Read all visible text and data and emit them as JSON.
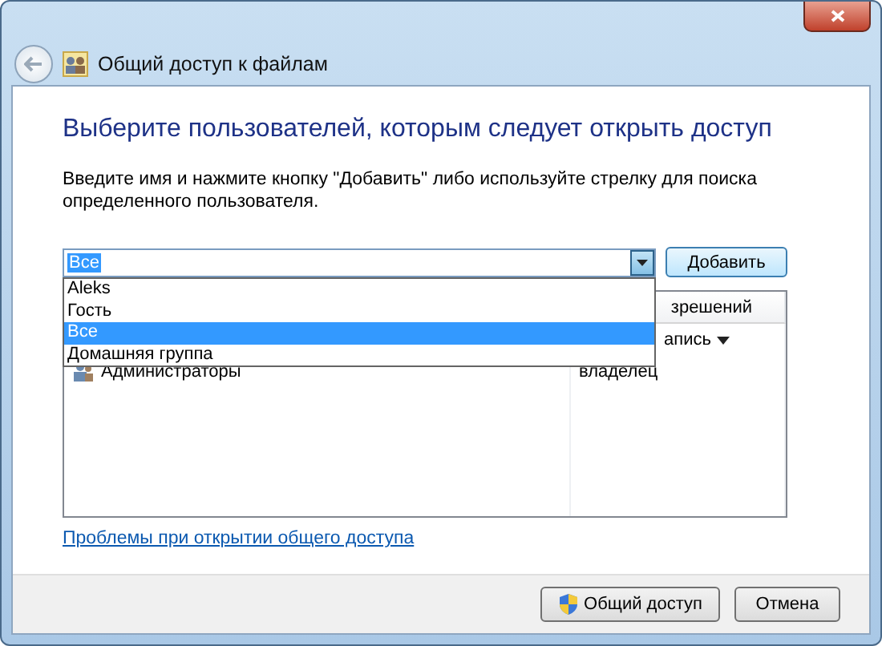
{
  "window": {
    "title": "Общий доступ к файлам"
  },
  "heading": "Выберите пользователей, которым следует открыть доступ",
  "instruction": "Введите имя и нажмите кнопку \"Добавить\" либо используйте стрелку для поиска определенного пользователя.",
  "combo": {
    "value": "Все",
    "expanded": true,
    "options": [
      {
        "label": "Aleks",
        "selected": false
      },
      {
        "label": "Гость",
        "selected": false
      },
      {
        "label": "Все",
        "selected": true
      },
      {
        "label": "Домашняя группа",
        "selected": false
      }
    ]
  },
  "add_button": "Добавить",
  "table": {
    "columns": [
      "",
      "зрешений"
    ],
    "rows": [
      {
        "name": "",
        "level": "апись",
        "has_menu": true
      },
      {
        "name": "Администраторы",
        "level": "владелец",
        "has_menu": false
      }
    ]
  },
  "help_link": "Проблемы при открытии общего доступа",
  "buttons": [
    {
      "label": "Общий доступ",
      "kind": "shield"
    },
    {
      "label": "Отмена",
      "kind": "plain"
    }
  ]
}
